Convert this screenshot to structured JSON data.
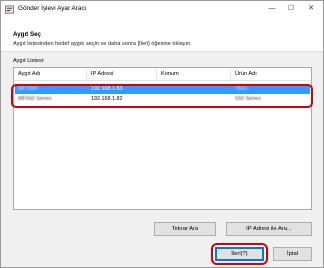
{
  "window": {
    "title": "Gönder İşlevi Ayar Aracı",
    "controls": {
      "minimize": "—",
      "maximize": "☐",
      "close": "✕"
    }
  },
  "header": {
    "heading": "Aygıt Seç",
    "instruction": "Aygıt listesinden hedef aygıtı seçin ve daha sonra [İleri] öğesine tıklayın."
  },
  "device_list": {
    "label": "Aygıt Listesi:",
    "columns": [
      "Aygıt Adı",
      "IP Adresi",
      "Konum",
      "Ürün Adı"
    ],
    "rows": [
      {
        "device_name": "MF755C",
        "ip": "192.168.1.83",
        "location": "",
        "product": "755C",
        "selected": true
      },
      {
        "device_name": "MF550 Series",
        "ip": "192.168.1.82",
        "location": "",
        "product": "550 Series",
        "selected": false
      }
    ]
  },
  "buttons": {
    "retry": "Tekrar Ara",
    "search_by_ip": "IP Adresi ile Ara...",
    "next": "İleri(?)",
    "cancel": "İptal"
  },
  "colors": {
    "selection": "#3399ff",
    "highlight": "#d0000d"
  }
}
